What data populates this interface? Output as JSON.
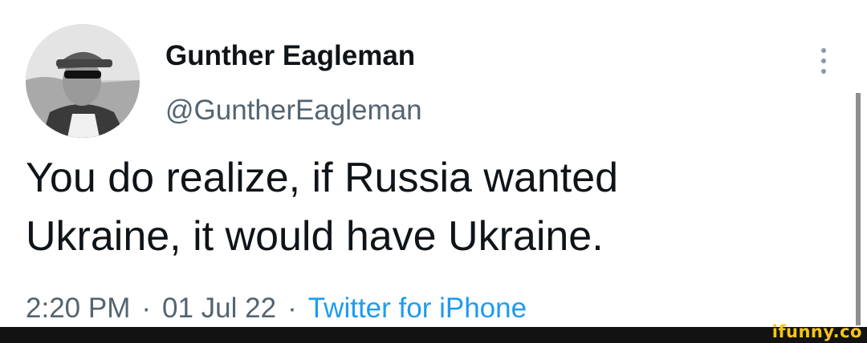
{
  "author": {
    "display_name": "Gunther Eagleman",
    "handle": "@GuntherEagleman"
  },
  "tweet": {
    "text_lines": [
      "You do realize, if Russia wanted",
      "Ukraine, it would have Ukraine."
    ],
    "time": "2:20 PM",
    "date": "01 Jul 22",
    "separator": "·",
    "source": "Twitter for iPhone"
  },
  "watermark": "ifunny.co",
  "colors": {
    "text_primary": "#0f1419",
    "text_secondary": "#536471",
    "link": "#1d9bf0",
    "watermark": "#f5c518"
  },
  "icons": {
    "more": "more-vertical-icon"
  }
}
